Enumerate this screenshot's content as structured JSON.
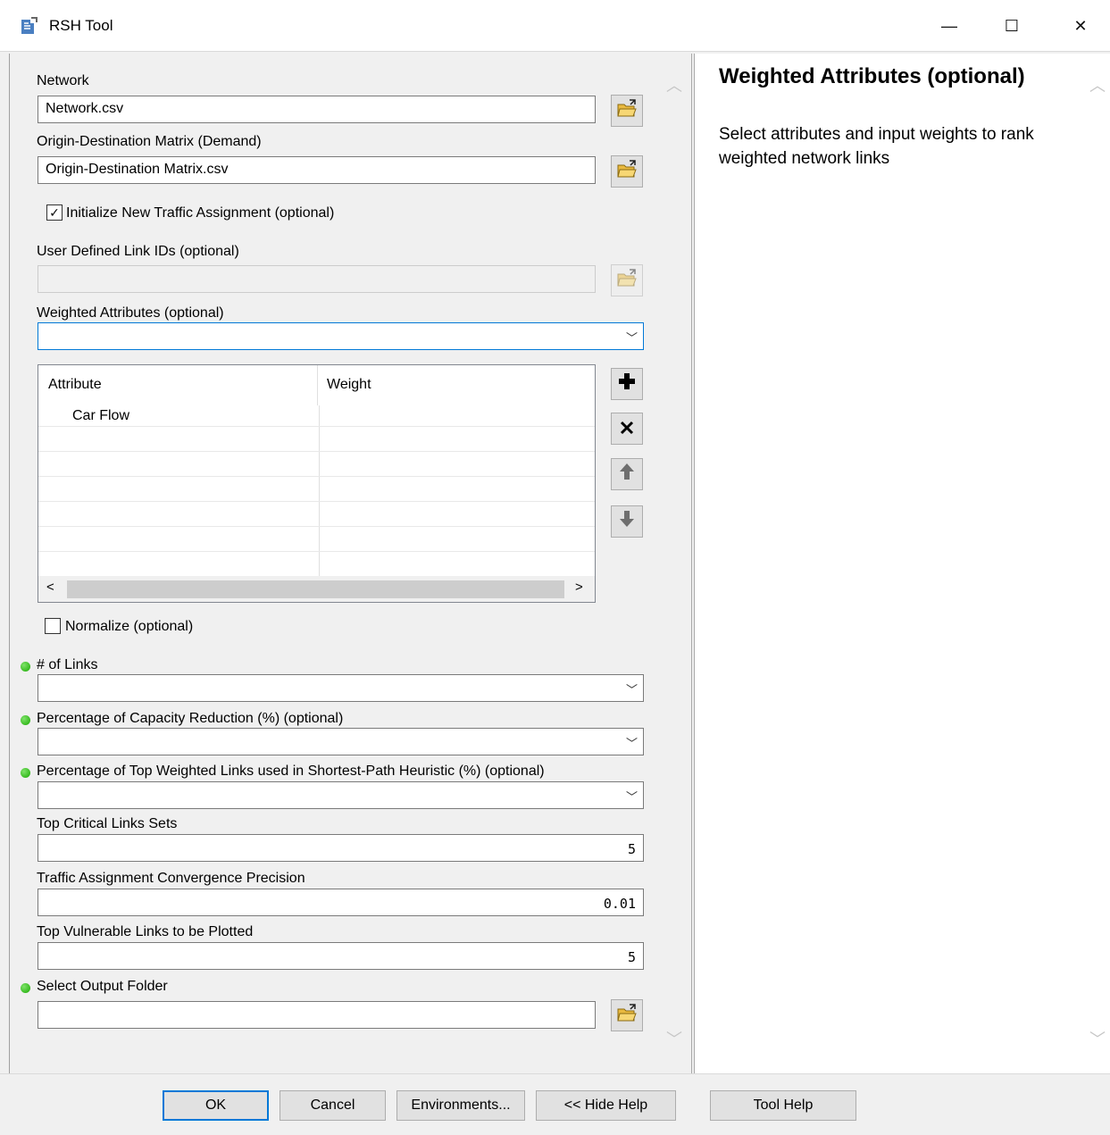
{
  "window": {
    "title": "RSH Tool",
    "minimize": "—",
    "maximize": "☐",
    "close": "✕"
  },
  "form": {
    "network": {
      "label": "Network",
      "value": "Network.csv"
    },
    "od_matrix": {
      "label": "Origin-Destination Matrix (Demand)",
      "value": "Origin-Destination Matrix.csv"
    },
    "init_assignment": {
      "label": "Initialize New Traffic Assignment (optional)",
      "checked": true,
      "check": "✓"
    },
    "link_ids": {
      "label": "User Defined Link IDs (optional)",
      "value": ""
    },
    "weighted_attributes": {
      "label": "Weighted Attributes (optional)",
      "value": "",
      "columns": [
        "Attribute",
        "Weight"
      ],
      "rows": [
        {
          "attribute": "Car Flow",
          "weight": ""
        }
      ]
    },
    "normalize": {
      "label": "Normalize (optional)",
      "checked": false
    },
    "num_links": {
      "label": "# of Links",
      "value": ""
    },
    "capacity_reduction": {
      "label": "Percentage of Capacity Reduction (%) (optional)",
      "value": ""
    },
    "top_weighted": {
      "label": "Percentage of Top Weighted Links used in Shortest-Path Heuristic (%) (optional)",
      "value": ""
    },
    "critical_sets": {
      "label": "Top Critical Links Sets",
      "value": "5"
    },
    "convergence": {
      "label": "Traffic Assignment Convergence Precision",
      "value": "0.01"
    },
    "vulnerable_links": {
      "label": "Top Vulnerable Links to be Plotted",
      "value": "5"
    },
    "output_folder": {
      "label": "Select Output Folder",
      "value": ""
    }
  },
  "help": {
    "title": "Weighted Attributes (optional)",
    "body": "Select attributes and input weights to rank weighted network links"
  },
  "buttons": {
    "ok": "OK",
    "cancel": "Cancel",
    "environments": "Environments...",
    "hide_help": "<< Hide Help",
    "tool_help": "Tool Help"
  },
  "icons": {
    "folder": "open-folder-icon",
    "add": "plus-icon",
    "remove": "x-icon",
    "up": "arrow-up-icon",
    "down": "arrow-down-icon",
    "required": "green-dot-icon"
  },
  "colors": {
    "accent": "#0078d7",
    "required_dot": "#18a900",
    "folder_yellow": "#f2c94c"
  }
}
